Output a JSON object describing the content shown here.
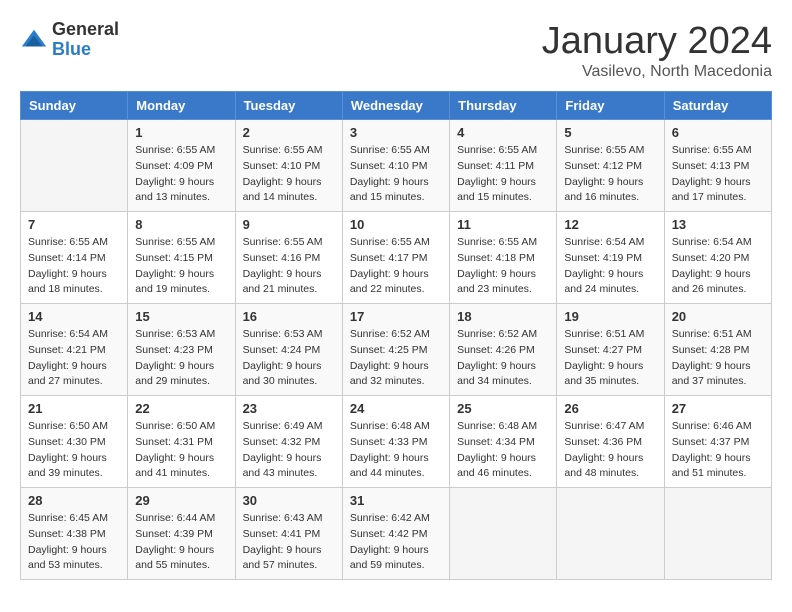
{
  "logo": {
    "general": "General",
    "blue": "Blue"
  },
  "title": "January 2024",
  "subtitle": "Vasilevo, North Macedonia",
  "headers": [
    "Sunday",
    "Monday",
    "Tuesday",
    "Wednesday",
    "Thursday",
    "Friday",
    "Saturday"
  ],
  "weeks": [
    [
      {
        "day": "",
        "sunrise": "",
        "sunset": "",
        "daylight": ""
      },
      {
        "day": "1",
        "sunrise": "Sunrise: 6:55 AM",
        "sunset": "Sunset: 4:09 PM",
        "daylight": "Daylight: 9 hours and 13 minutes."
      },
      {
        "day": "2",
        "sunrise": "Sunrise: 6:55 AM",
        "sunset": "Sunset: 4:10 PM",
        "daylight": "Daylight: 9 hours and 14 minutes."
      },
      {
        "day": "3",
        "sunrise": "Sunrise: 6:55 AM",
        "sunset": "Sunset: 4:10 PM",
        "daylight": "Daylight: 9 hours and 15 minutes."
      },
      {
        "day": "4",
        "sunrise": "Sunrise: 6:55 AM",
        "sunset": "Sunset: 4:11 PM",
        "daylight": "Daylight: 9 hours and 15 minutes."
      },
      {
        "day": "5",
        "sunrise": "Sunrise: 6:55 AM",
        "sunset": "Sunset: 4:12 PM",
        "daylight": "Daylight: 9 hours and 16 minutes."
      },
      {
        "day": "6",
        "sunrise": "Sunrise: 6:55 AM",
        "sunset": "Sunset: 4:13 PM",
        "daylight": "Daylight: 9 hours and 17 minutes."
      }
    ],
    [
      {
        "day": "7",
        "sunrise": "Sunrise: 6:55 AM",
        "sunset": "Sunset: 4:14 PM",
        "daylight": "Daylight: 9 hours and 18 minutes."
      },
      {
        "day": "8",
        "sunrise": "Sunrise: 6:55 AM",
        "sunset": "Sunset: 4:15 PM",
        "daylight": "Daylight: 9 hours and 19 minutes."
      },
      {
        "day": "9",
        "sunrise": "Sunrise: 6:55 AM",
        "sunset": "Sunset: 4:16 PM",
        "daylight": "Daylight: 9 hours and 21 minutes."
      },
      {
        "day": "10",
        "sunrise": "Sunrise: 6:55 AM",
        "sunset": "Sunset: 4:17 PM",
        "daylight": "Daylight: 9 hours and 22 minutes."
      },
      {
        "day": "11",
        "sunrise": "Sunrise: 6:55 AM",
        "sunset": "Sunset: 4:18 PM",
        "daylight": "Daylight: 9 hours and 23 minutes."
      },
      {
        "day": "12",
        "sunrise": "Sunrise: 6:54 AM",
        "sunset": "Sunset: 4:19 PM",
        "daylight": "Daylight: 9 hours and 24 minutes."
      },
      {
        "day": "13",
        "sunrise": "Sunrise: 6:54 AM",
        "sunset": "Sunset: 4:20 PM",
        "daylight": "Daylight: 9 hours and 26 minutes."
      }
    ],
    [
      {
        "day": "14",
        "sunrise": "Sunrise: 6:54 AM",
        "sunset": "Sunset: 4:21 PM",
        "daylight": "Daylight: 9 hours and 27 minutes."
      },
      {
        "day": "15",
        "sunrise": "Sunrise: 6:53 AM",
        "sunset": "Sunset: 4:23 PM",
        "daylight": "Daylight: 9 hours and 29 minutes."
      },
      {
        "day": "16",
        "sunrise": "Sunrise: 6:53 AM",
        "sunset": "Sunset: 4:24 PM",
        "daylight": "Daylight: 9 hours and 30 minutes."
      },
      {
        "day": "17",
        "sunrise": "Sunrise: 6:52 AM",
        "sunset": "Sunset: 4:25 PM",
        "daylight": "Daylight: 9 hours and 32 minutes."
      },
      {
        "day": "18",
        "sunrise": "Sunrise: 6:52 AM",
        "sunset": "Sunset: 4:26 PM",
        "daylight": "Daylight: 9 hours and 34 minutes."
      },
      {
        "day": "19",
        "sunrise": "Sunrise: 6:51 AM",
        "sunset": "Sunset: 4:27 PM",
        "daylight": "Daylight: 9 hours and 35 minutes."
      },
      {
        "day": "20",
        "sunrise": "Sunrise: 6:51 AM",
        "sunset": "Sunset: 4:28 PM",
        "daylight": "Daylight: 9 hours and 37 minutes."
      }
    ],
    [
      {
        "day": "21",
        "sunrise": "Sunrise: 6:50 AM",
        "sunset": "Sunset: 4:30 PM",
        "daylight": "Daylight: 9 hours and 39 minutes."
      },
      {
        "day": "22",
        "sunrise": "Sunrise: 6:50 AM",
        "sunset": "Sunset: 4:31 PM",
        "daylight": "Daylight: 9 hours and 41 minutes."
      },
      {
        "day": "23",
        "sunrise": "Sunrise: 6:49 AM",
        "sunset": "Sunset: 4:32 PM",
        "daylight": "Daylight: 9 hours and 43 minutes."
      },
      {
        "day": "24",
        "sunrise": "Sunrise: 6:48 AM",
        "sunset": "Sunset: 4:33 PM",
        "daylight": "Daylight: 9 hours and 44 minutes."
      },
      {
        "day": "25",
        "sunrise": "Sunrise: 6:48 AM",
        "sunset": "Sunset: 4:34 PM",
        "daylight": "Daylight: 9 hours and 46 minutes."
      },
      {
        "day": "26",
        "sunrise": "Sunrise: 6:47 AM",
        "sunset": "Sunset: 4:36 PM",
        "daylight": "Daylight: 9 hours and 48 minutes."
      },
      {
        "day": "27",
        "sunrise": "Sunrise: 6:46 AM",
        "sunset": "Sunset: 4:37 PM",
        "daylight": "Daylight: 9 hours and 51 minutes."
      }
    ],
    [
      {
        "day": "28",
        "sunrise": "Sunrise: 6:45 AM",
        "sunset": "Sunset: 4:38 PM",
        "daylight": "Daylight: 9 hours and 53 minutes."
      },
      {
        "day": "29",
        "sunrise": "Sunrise: 6:44 AM",
        "sunset": "Sunset: 4:39 PM",
        "daylight": "Daylight: 9 hours and 55 minutes."
      },
      {
        "day": "30",
        "sunrise": "Sunrise: 6:43 AM",
        "sunset": "Sunset: 4:41 PM",
        "daylight": "Daylight: 9 hours and 57 minutes."
      },
      {
        "day": "31",
        "sunrise": "Sunrise: 6:42 AM",
        "sunset": "Sunset: 4:42 PM",
        "daylight": "Daylight: 9 hours and 59 minutes."
      },
      {
        "day": "",
        "sunrise": "",
        "sunset": "",
        "daylight": ""
      },
      {
        "day": "",
        "sunrise": "",
        "sunset": "",
        "daylight": ""
      },
      {
        "day": "",
        "sunrise": "",
        "sunset": "",
        "daylight": ""
      }
    ]
  ]
}
